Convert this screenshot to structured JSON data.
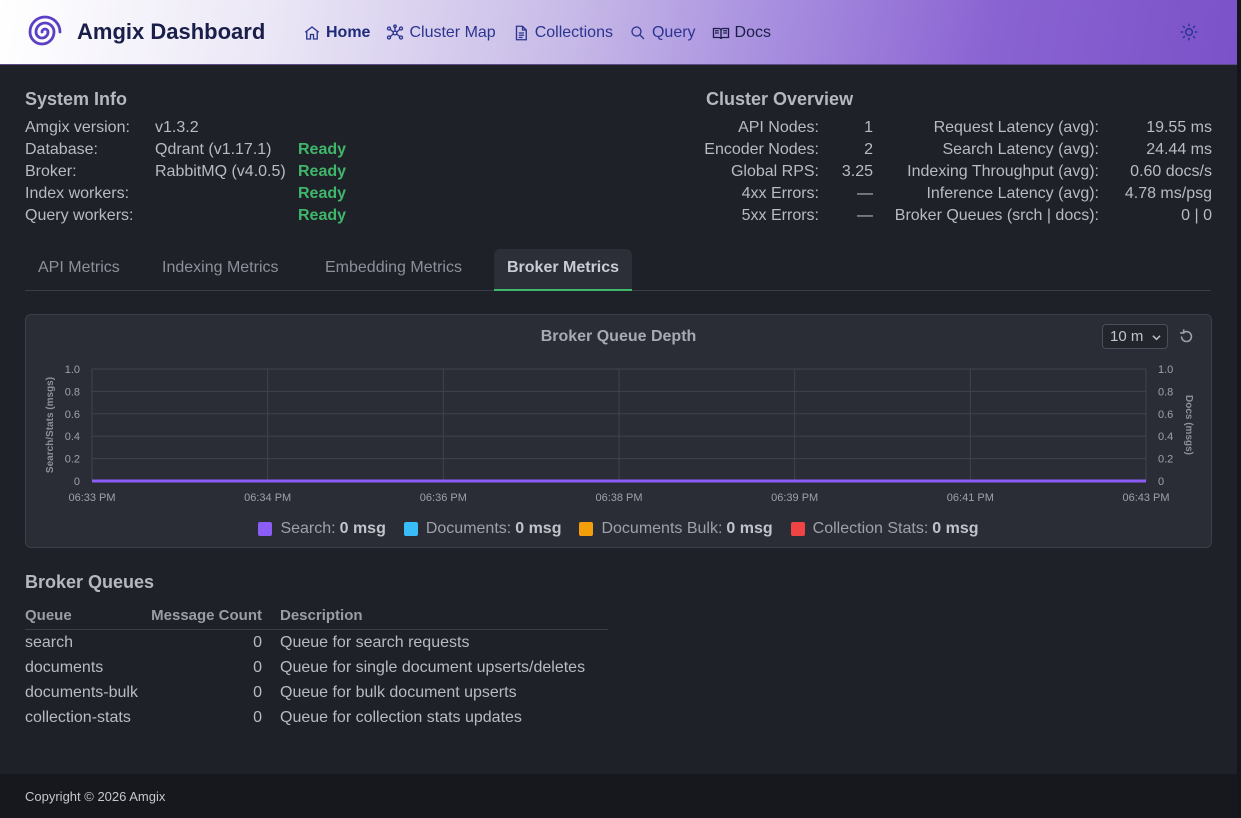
{
  "header": {
    "brand": "Amgix Dashboard",
    "nav": [
      {
        "label": "Home",
        "icon": "home-icon",
        "active": true
      },
      {
        "label": "Cluster Map",
        "icon": "network-icon"
      },
      {
        "label": "Collections",
        "icon": "document-icon"
      },
      {
        "label": "Query",
        "icon": "search-icon"
      },
      {
        "label": "Docs",
        "icon": "book-icon"
      }
    ],
    "theme_icon": "sun-icon"
  },
  "system_info": {
    "title": "System Info",
    "rows": [
      {
        "key": "Amgix version:",
        "value": "v1.3.2",
        "status": ""
      },
      {
        "key": "Database:",
        "value": "Qdrant (v1.17.1)",
        "status": "Ready"
      },
      {
        "key": "Broker:",
        "value": "RabbitMQ (v4.0.5)",
        "status": "Ready"
      },
      {
        "key": "Index workers:",
        "value": "",
        "status": "Ready"
      },
      {
        "key": "Query workers:",
        "value": "",
        "status": "Ready"
      }
    ]
  },
  "cluster_overview": {
    "title": "Cluster Overview",
    "left": [
      {
        "key": "API Nodes:",
        "value": "1"
      },
      {
        "key": "Encoder Nodes:",
        "value": "2"
      },
      {
        "key": "Global RPS:",
        "value": "3.25"
      },
      {
        "key": "4xx Errors:",
        "value": "—"
      },
      {
        "key": "5xx Errors:",
        "value": "—"
      }
    ],
    "right": [
      {
        "key": "Request Latency (avg):",
        "value": "19.55 ms",
        "highlight": true
      },
      {
        "key": "Search Latency (avg):",
        "value": "24.44 ms",
        "highlight": true
      },
      {
        "key": "Indexing Throughput (avg):",
        "value": "0.60 docs/s",
        "highlight": false
      },
      {
        "key": "Inference Latency (avg):",
        "value": "4.78 ms/psg",
        "highlight": false
      },
      {
        "key": "Broker Queues (srch | docs):",
        "value": "0 | 0",
        "highlight": false
      }
    ]
  },
  "tabs": [
    {
      "label": "API Metrics",
      "active": false
    },
    {
      "label": "Indexing Metrics",
      "active": false
    },
    {
      "label": "Embedding Metrics",
      "active": false
    },
    {
      "label": "Broker Metrics",
      "active": true
    }
  ],
  "chart_panel": {
    "range_select": "10 m",
    "refresh_icon": "refresh-icon"
  },
  "chart_data": {
    "type": "line",
    "title": "Broker Queue Depth",
    "ylabel": "Search/Stats (msgs)",
    "y2label": "Docs (msgs)",
    "xlabel": "",
    "ylim": [
      0,
      1
    ],
    "y2lim": [
      0,
      1
    ],
    "yticks": [
      "0",
      "0.2",
      "0.4",
      "0.6",
      "0.8",
      "1.0"
    ],
    "xticks": [
      "06:33 PM",
      "06:34 PM",
      "06:36 PM",
      "06:38 PM",
      "06:39 PM",
      "06:41 PM",
      "06:43 PM"
    ],
    "grid": true,
    "legend_position": "bottom",
    "series": [
      {
        "name": "Search",
        "color": "#8b5cf6",
        "summary": "0 msg",
        "values": [
          0,
          0,
          0,
          0,
          0,
          0,
          0
        ]
      },
      {
        "name": "Documents",
        "color": "#38bdf8",
        "summary": "0 msg",
        "values": [
          0,
          0,
          0,
          0,
          0,
          0,
          0
        ]
      },
      {
        "name": "Documents Bulk",
        "color": "#f59e0b",
        "summary": "0 msg",
        "values": [
          0,
          0,
          0,
          0,
          0,
          0,
          0
        ]
      },
      {
        "name": "Collection Stats",
        "color": "#ef4444",
        "summary": "0 msg",
        "values": [
          0,
          0,
          0,
          0,
          0,
          0,
          0
        ]
      }
    ]
  },
  "broker_queues": {
    "title": "Broker Queues",
    "columns": [
      "Queue",
      "Message Count",
      "Description"
    ],
    "rows": [
      {
        "queue": "search",
        "count": "0",
        "description": "Queue for search requests"
      },
      {
        "queue": "documents",
        "count": "0",
        "description": "Queue for single document upserts/deletes"
      },
      {
        "queue": "documents-bulk",
        "count": "0",
        "description": "Queue for bulk document upserts"
      },
      {
        "queue": "collection-stats",
        "count": "0",
        "description": "Queue for collection stats updates"
      }
    ]
  },
  "footer": {
    "text": "Copyright © 2026 Amgix"
  },
  "colors": {
    "ready": "#3fb76a",
    "latency_highlight": "#3fcc3f",
    "accent": "#7b52c8"
  }
}
